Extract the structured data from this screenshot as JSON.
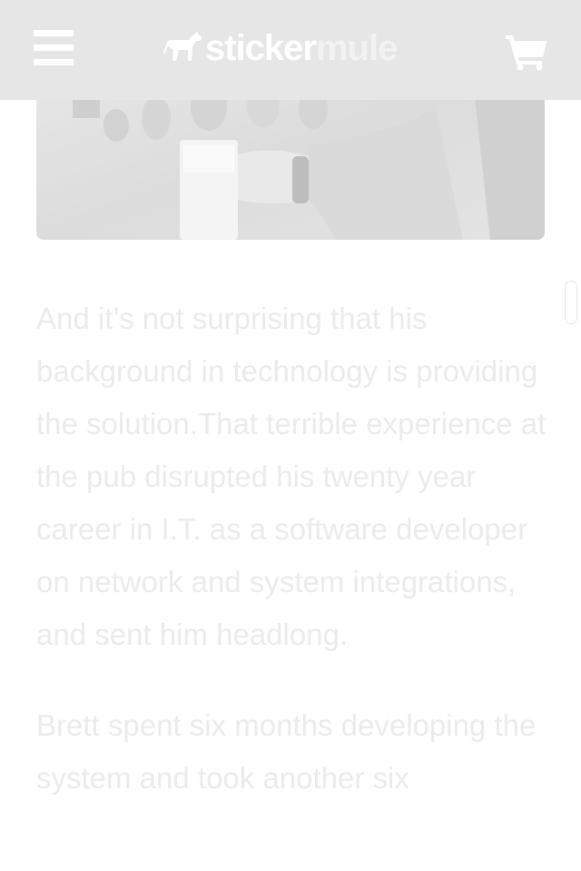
{
  "header": {
    "menu_icon": "hamburger-menu-icon",
    "logo_sticker": "sticker",
    "logo_mule": "mule",
    "cart_icon": "shopping-cart-icon",
    "background_color": "#e6e6e6"
  },
  "hero": {
    "image": "bartender-pouring-beer-photo"
  },
  "article": {
    "paragraphs": [
      "And it’s not surprising that his background in technology is providing the solution.That terrible experience at the pub disrupted his twenty year career in I.T. as a software developer on network and system integrations, and sent him headlong.",
      "Brett spent six months developing the system and took another six"
    ],
    "text_color": "#ebebeb"
  }
}
